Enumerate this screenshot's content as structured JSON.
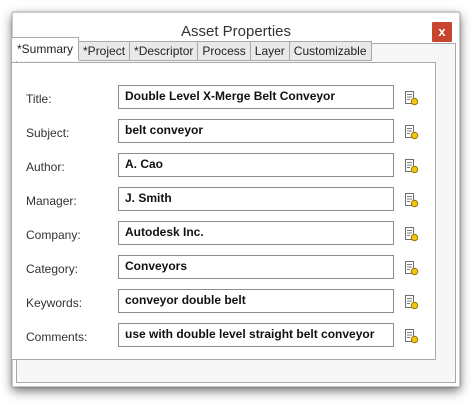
{
  "dialog": {
    "title": "Asset Properties",
    "close_label": "x"
  },
  "tabs": [
    {
      "label": "*Summary",
      "active": true
    },
    {
      "label": "*Project"
    },
    {
      "label": "*Descriptor"
    },
    {
      "label": "Process"
    },
    {
      "label": "Layer"
    },
    {
      "label": "Customizable"
    }
  ],
  "fields": [
    {
      "label": "Title:",
      "value": "Double Level X-Merge Belt Conveyor"
    },
    {
      "label": "Subject:",
      "value": "belt conveyor"
    },
    {
      "label": "Author:",
      "value": "A. Cao"
    },
    {
      "label": "Manager:",
      "value": "J. Smith"
    },
    {
      "label": "Company:",
      "value": "Autodesk Inc."
    },
    {
      "label": "Category:",
      "value": "Conveyors"
    },
    {
      "label": "Keywords:",
      "value": "conveyor double belt"
    },
    {
      "label": "Comments:",
      "value": "use with double level straight belt conveyor"
    }
  ],
  "icons": {
    "field_action": "edit-properties-icon"
  },
  "colors": {
    "close_button": "#c7442f",
    "panel_bg": "#f7f7f7",
    "border": "#a9a9a9"
  }
}
